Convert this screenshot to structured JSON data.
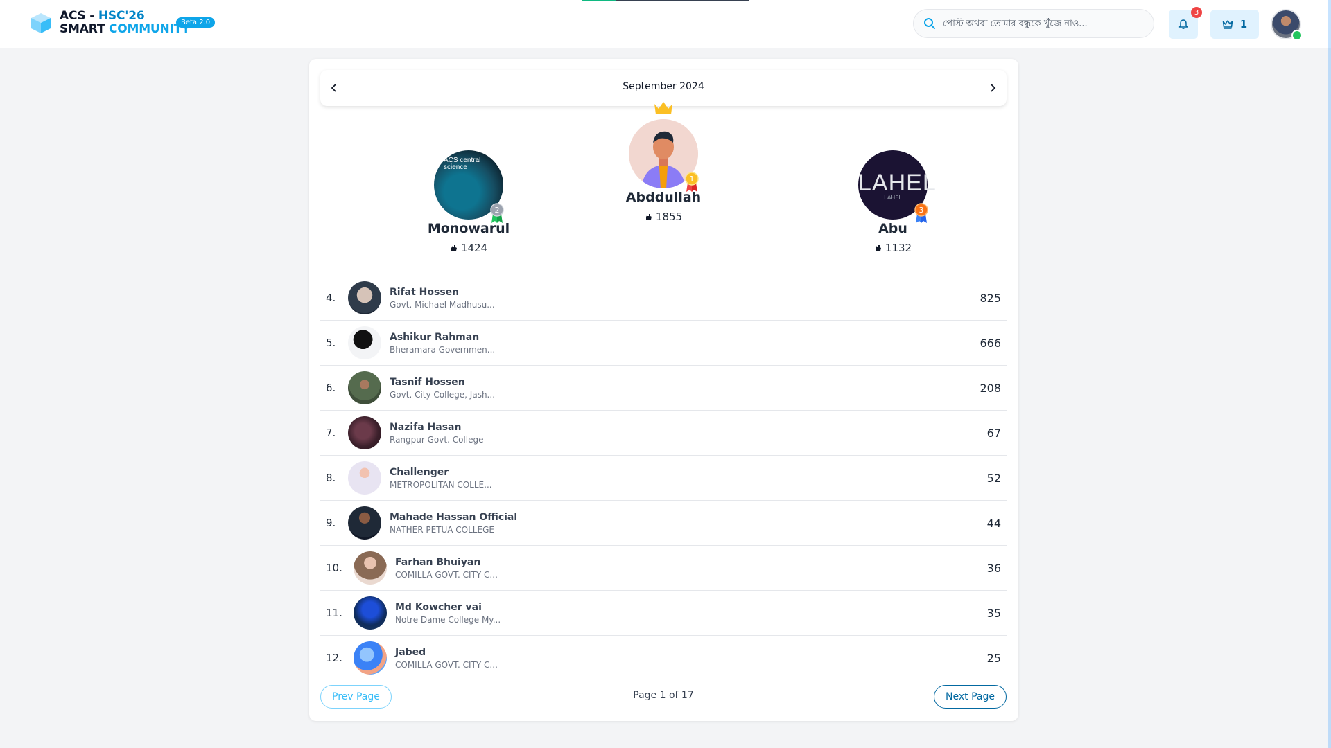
{
  "header": {
    "logo_line1_a": "ACS - ",
    "logo_line1_b": "HSC'26",
    "logo_line2_a": "SMART ",
    "logo_line2_b": "COMMUNITY",
    "beta_badge": "Beta 2.0",
    "search_placeholder": "পোস্ট অথবা তোমার বন্ধুকে খুঁজে নাও...",
    "notification_count": "3",
    "crown_count": "1",
    "progress_fraction": 0.2
  },
  "leaderboard": {
    "month": "September 2024",
    "podium": [
      {
        "rank": "2",
        "name": "Monowarul",
        "score": "1424",
        "avatar": "science"
      },
      {
        "rank": "1",
        "name": "Abddullah",
        "score": "1855",
        "avatar": "cartoon"
      },
      {
        "rank": "3",
        "name": "Abu",
        "score": "1132",
        "avatar": "lahel"
      }
    ],
    "avatar_texts": {
      "science": "ACS central science",
      "lahel": "LAHEL",
      "lahel_sub": "LAHEL"
    },
    "rows": [
      {
        "rank": "4.",
        "name": "Rifat Hossen",
        "college": "Govt. Michael Madhusu...",
        "score": "825"
      },
      {
        "rank": "5.",
        "name": "Ashikur Rahman",
        "college": "Bheramara Governmen...",
        "score": "666"
      },
      {
        "rank": "6.",
        "name": "Tasnif Hossen",
        "college": "Govt. City College, Jash...",
        "score": "208"
      },
      {
        "rank": "7.",
        "name": "Nazifa Hasan",
        "college": "Rangpur Govt. College",
        "score": "67"
      },
      {
        "rank": "8.",
        "name": "Challenger",
        "college": "METROPOLITAN COLLE...",
        "score": "52"
      },
      {
        "rank": "9.",
        "name": "Mahade Hassan Official",
        "college": "NATHER PETUA COLLEGE",
        "score": "44"
      },
      {
        "rank": "10.",
        "name": "Farhan Bhuiyan",
        "college": "COMILLA GOVT. CITY C...",
        "score": "36"
      },
      {
        "rank": "11.",
        "name": "Md Kowcher vai",
        "college": "Notre Dame College My...",
        "score": "35"
      },
      {
        "rank": "12.",
        "name": "Jabed",
        "college": "COMILLA GOVT. CITY C...",
        "score": "25"
      }
    ],
    "pagination": {
      "prev_label": "Prev Page",
      "next_label": "Next Page",
      "info": "Page 1 of 17"
    }
  },
  "colors": {
    "accent": "#0369a1",
    "brand": "#0ea5e9",
    "badge": "#ef4444",
    "online": "#22c55e"
  }
}
